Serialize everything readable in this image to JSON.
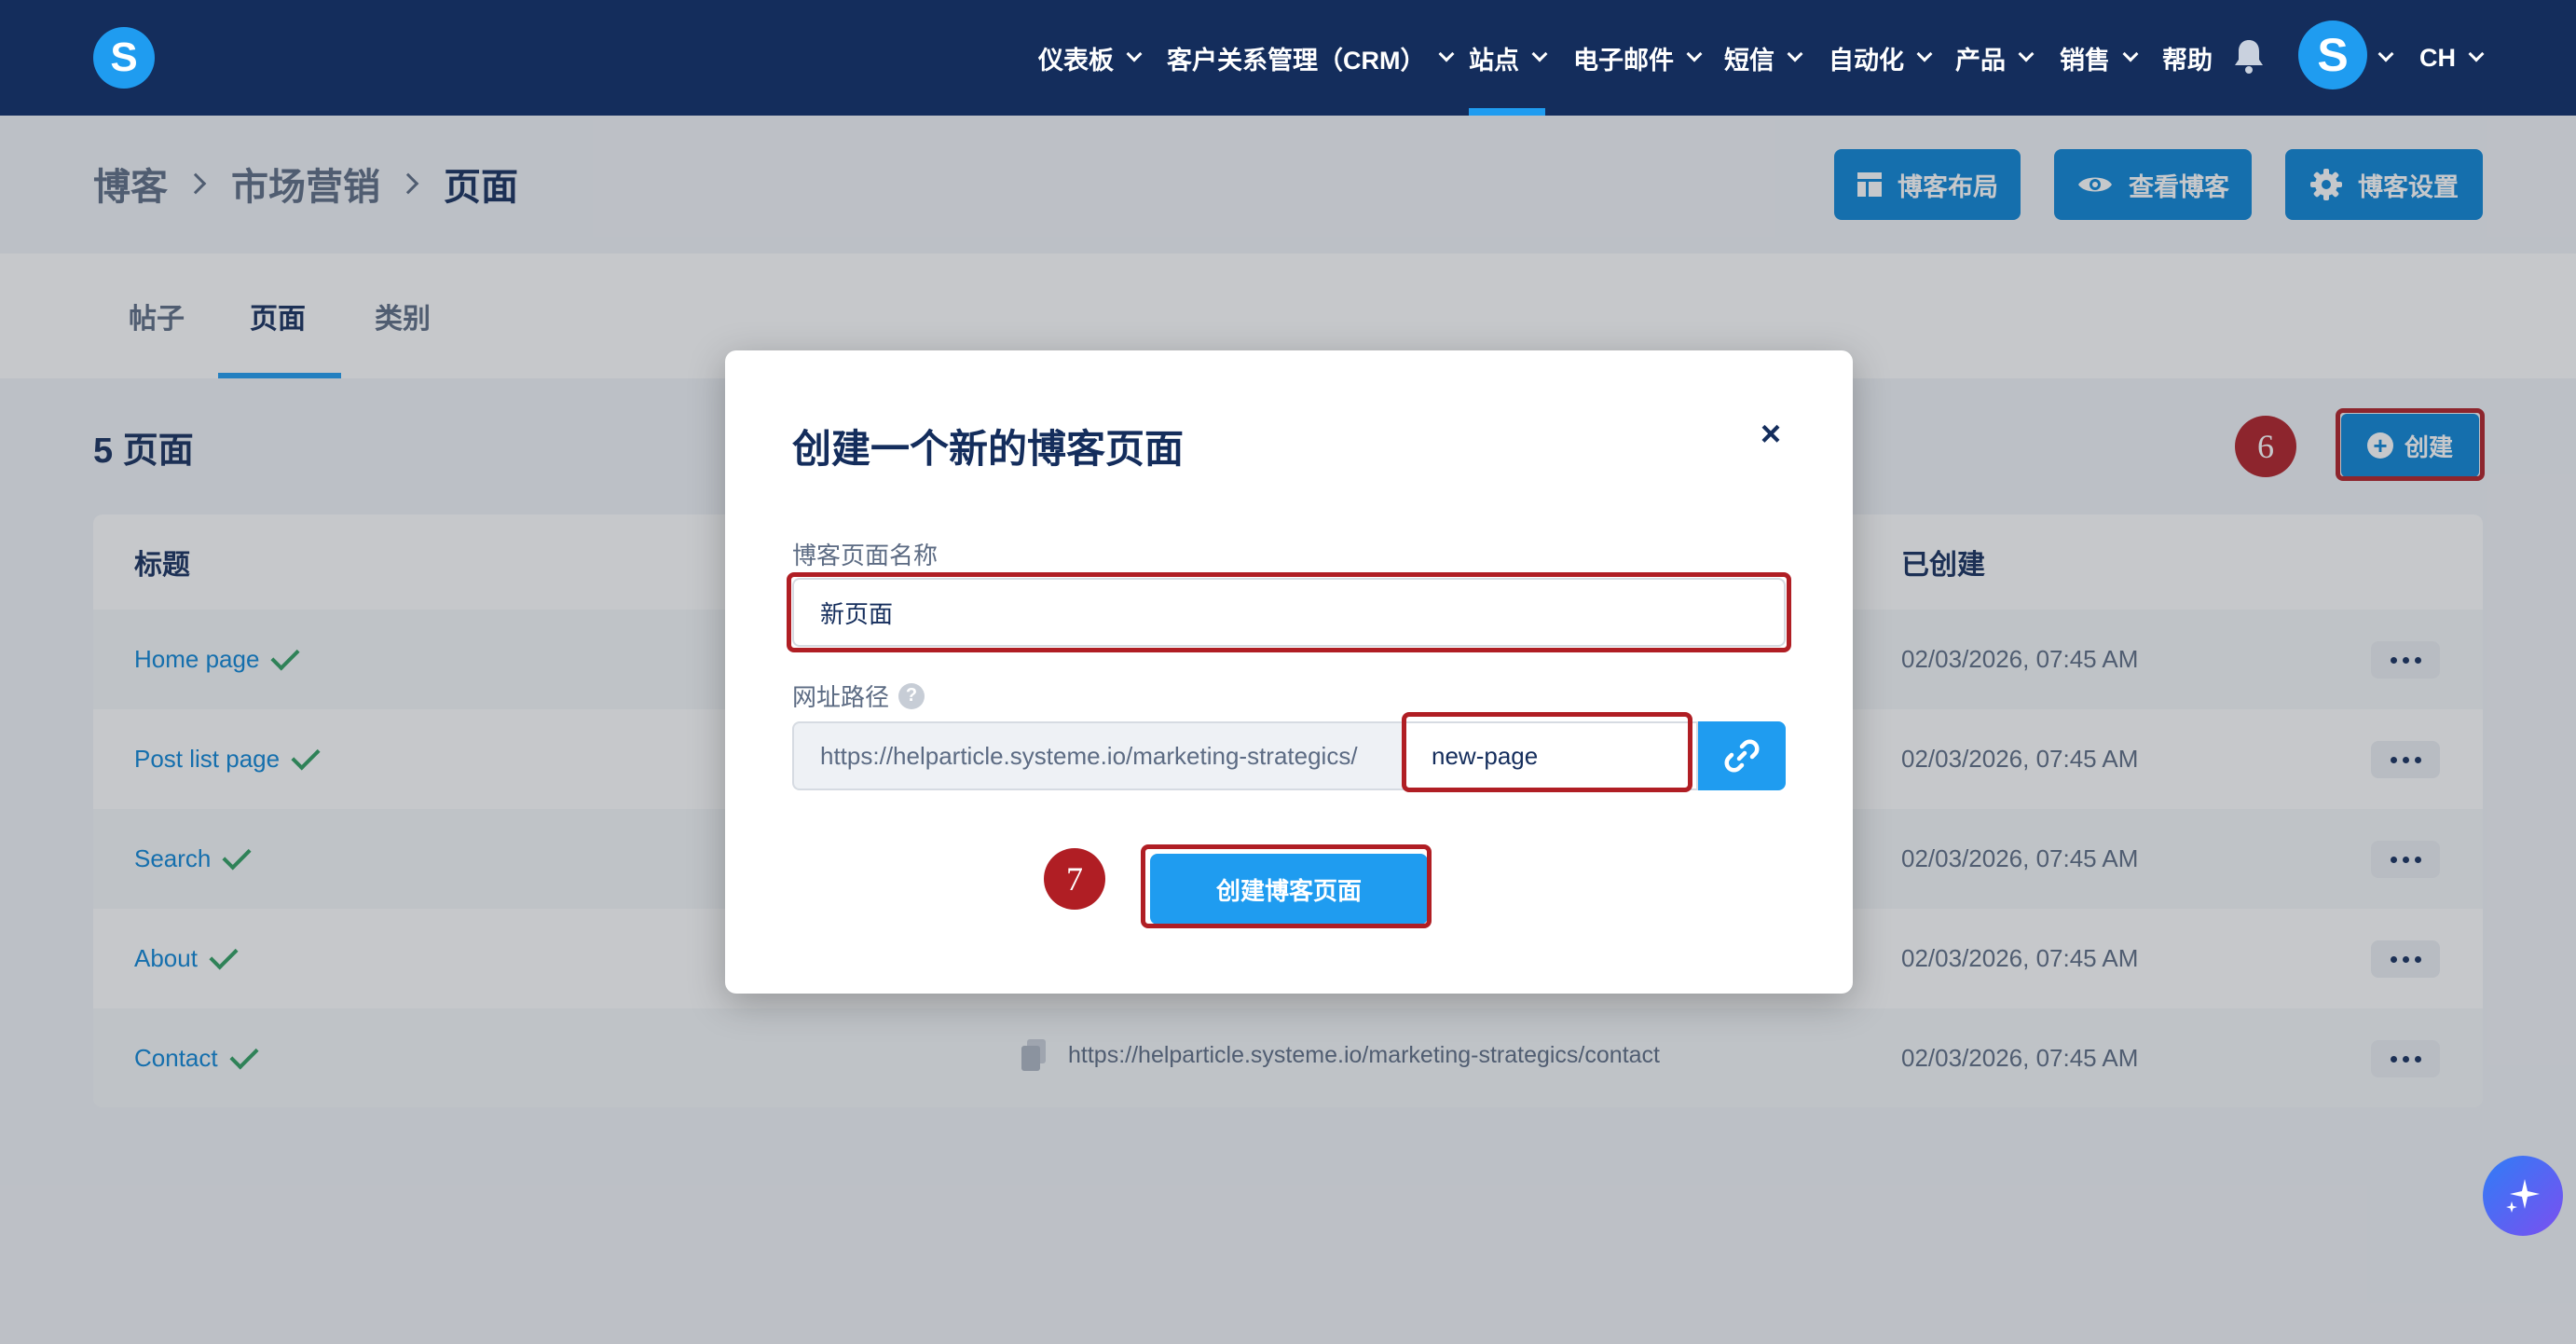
{
  "topnav": {
    "logo_letter": "S",
    "items": [
      {
        "label": "仪表板"
      },
      {
        "label": "客户关系管理（CRM）"
      },
      {
        "label": "站点"
      },
      {
        "label": "电子邮件"
      },
      {
        "label": "短信"
      },
      {
        "label": "自动化"
      },
      {
        "label": "产品"
      },
      {
        "label": "销售"
      },
      {
        "label": "帮助"
      }
    ],
    "active_item": "站点",
    "avatar_letter": "S",
    "language": "CH"
  },
  "breadcrumb": {
    "items": [
      "博客",
      "市场营销",
      "页面"
    ]
  },
  "header_buttons": {
    "layout": "博客布局",
    "view": "查看博客",
    "settings": "博客设置"
  },
  "tabs": [
    {
      "label": "帖子"
    },
    {
      "label": "页面"
    },
    {
      "label": "类别"
    }
  ],
  "active_tab": "页面",
  "page_count_title": "5 页面",
  "create_button": "创建",
  "steps": {
    "create": "6",
    "submit": "7"
  },
  "table": {
    "columns": {
      "title": "标题",
      "created": "已创建"
    },
    "rows": [
      {
        "title": "Home page",
        "created": "02/03/2026, 07:45 AM"
      },
      {
        "title": "Post list page",
        "created": "02/03/2026, 07:45 AM"
      },
      {
        "title": "Search",
        "created": "02/03/2026, 07:45 AM"
      },
      {
        "title": "About",
        "created": "02/03/2026, 07:45 AM"
      },
      {
        "title": "Contact",
        "url": "https://helparticle.systeme.io/marketing-strategics/contact",
        "created": "02/03/2026, 07:45 AM"
      }
    ]
  },
  "modal": {
    "title": "创建一个新的博客页面",
    "close": "×",
    "name_label": "博客页面名称",
    "name_value": "新页面",
    "path_label": "网址路径",
    "help": "?",
    "url_prefix": "https://helparticle.systeme.io/marketing-strategics/",
    "slug_value": "new-page",
    "submit": "创建博客页面"
  },
  "colors": {
    "nav_bg": "#142d5c",
    "primary": "#1f9cf0",
    "button": "#0b84d6",
    "highlight": "#b01e24",
    "check": "#2e9e60"
  }
}
